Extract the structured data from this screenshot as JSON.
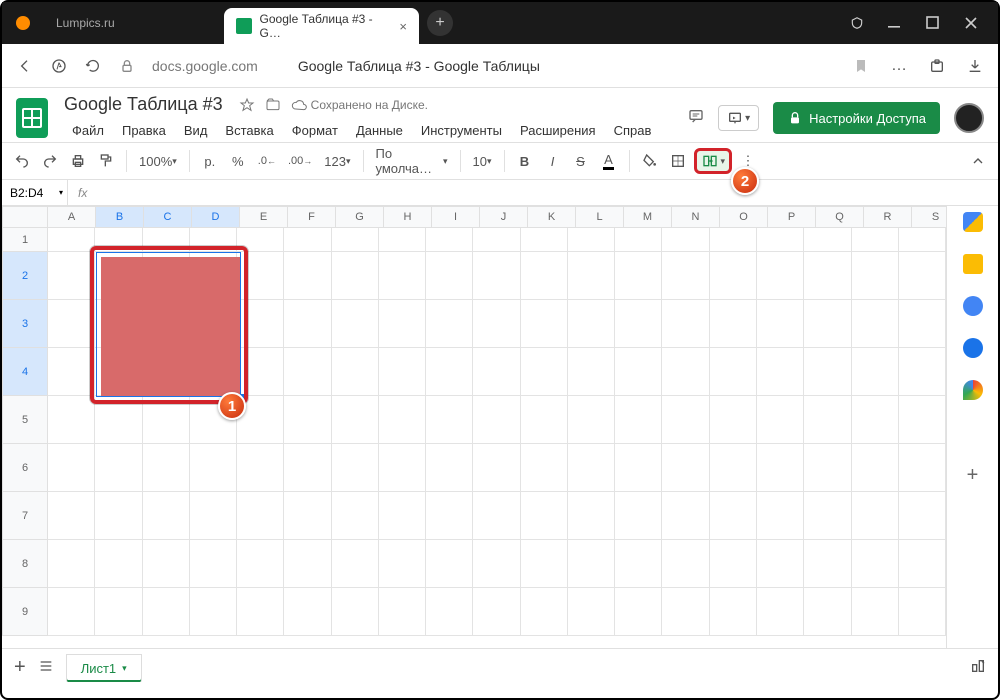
{
  "browser": {
    "tabs": [
      {
        "label": "Lumpics.ru",
        "active": false
      },
      {
        "label": "Google Таблица #3 - G…",
        "active": true
      }
    ],
    "url": "docs.google.com",
    "page_title": "Google Таблица #3 - Google Таблицы"
  },
  "doc": {
    "title": "Google Таблица #3",
    "saved_text": "Сохранено на Диске.",
    "share_label": "Настройки Доступа"
  },
  "menus": [
    "Файл",
    "Правка",
    "Вид",
    "Вставка",
    "Формат",
    "Данные",
    "Инструменты",
    "Расширения",
    "Справ"
  ],
  "toolbar": {
    "zoom": "100%",
    "currency": "р.",
    "percent": "%",
    "dec_dec": ".0",
    "dec_inc": ".00",
    "numfmt": "123",
    "font": "По умолча…",
    "fontsize": "10"
  },
  "namebox": "B2:D4",
  "columns": [
    "A",
    "B",
    "C",
    "D",
    "E",
    "F",
    "G",
    "H",
    "I",
    "J",
    "K",
    "L",
    "M",
    "N",
    "O",
    "P",
    "Q",
    "R",
    "S"
  ],
  "selected_cols": [
    "B",
    "C",
    "D"
  ],
  "rows": [
    "1",
    "2",
    "3",
    "4",
    "5",
    "6",
    "7",
    "8",
    "9"
  ],
  "selected_rows": [
    "2",
    "3",
    "4"
  ],
  "sheet_tab": "Лист1",
  "badges": {
    "sel": "1",
    "toolbar": "2"
  }
}
